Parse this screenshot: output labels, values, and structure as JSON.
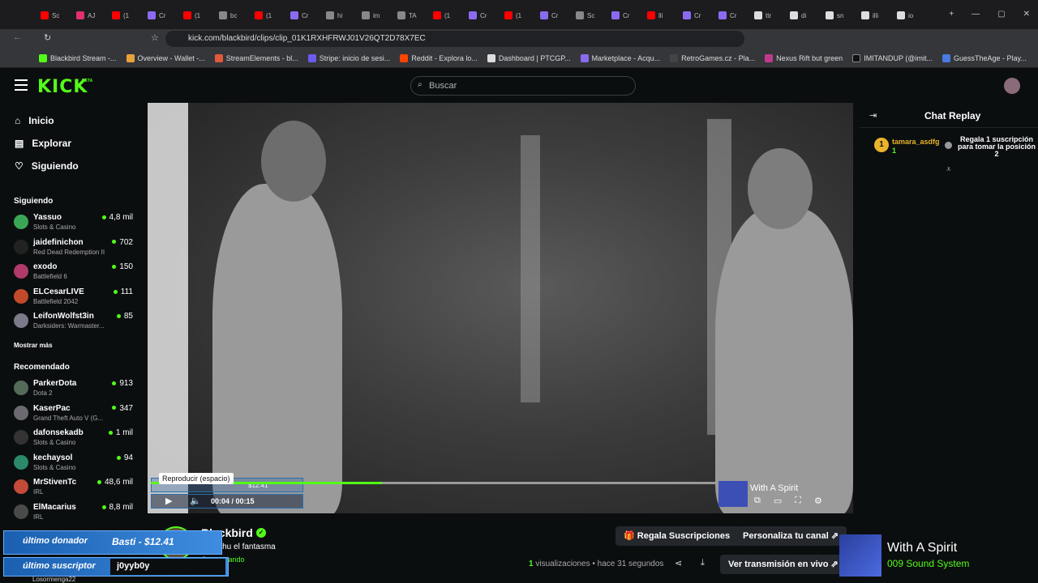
{
  "browser": {
    "tabs": [
      "Sc",
      "AJ",
      "(1",
      "Cr",
      "(1",
      "bc",
      "(1",
      "Cr",
      "hi",
      "im",
      "TA",
      "(1",
      "Cr",
      "(1",
      "Cr",
      "Sc",
      "Cr",
      "lli",
      "Cr",
      "Cr",
      "ttr",
      "di",
      "sn",
      "illi",
      "io"
    ],
    "url": "kick.com/blackbird/clips/clip_01K1RXHFRWJ01V26QT2D78X7EC",
    "bookmarks": [
      "Blackbird Stream -...",
      "Overview - Wallet -...",
      "StreamElements - bl...",
      "Stripe: inicio de sesi...",
      "Reddit - Explora lo...",
      "Dashboard | PTCGP...",
      "Marketplace - Acqu...",
      "RetroGames.cz - Pla...",
      "Nexus Rift but green",
      "IMITANDUP (@imit...",
      "GuessTheAge - Play..."
    ]
  },
  "header": {
    "logo": "KICK",
    "beta": "BETA",
    "search_placeholder": "Buscar"
  },
  "sidebar": {
    "nav": [
      {
        "label": "Inicio"
      },
      {
        "label": "Explorar"
      },
      {
        "label": "Siguiendo"
      }
    ],
    "following_title": "Siguiendo",
    "following": [
      {
        "name": "Yassuo",
        "category": "Slots & Casino",
        "viewers": "4,8 mil",
        "color": "#3aa655"
      },
      {
        "name": "jaidefinichon",
        "category": "Red Dead Redemption II",
        "viewers": "702",
        "color": "#222222"
      },
      {
        "name": "exodo",
        "category": "Battlefield 6",
        "viewers": "150",
        "color": "#b03a6a"
      },
      {
        "name": "ELCesarLIVE",
        "category": "Battlefield 2042",
        "viewers": "111",
        "color": "#c24a2a"
      },
      {
        "name": "LeifonWolfst3in",
        "category": "Darksiders: Warmaster...",
        "viewers": "85",
        "color": "#7a7a8a"
      }
    ],
    "show_more": "Mostrar más",
    "recommended_title": "Recomendado",
    "recommended": [
      {
        "name": "ParkerDota",
        "category": "Dota 2",
        "viewers": "913",
        "color": "#556b5a"
      },
      {
        "name": "KaserPac",
        "category": "Grand Theft Auto V (G...",
        "viewers": "347",
        "color": "#6a6a70"
      },
      {
        "name": "dafonsekadb",
        "category": "Slots & Casino",
        "viewers": "1 mil",
        "color": "#333333"
      },
      {
        "name": "kechaysol",
        "category": "Slots & Casino",
        "viewers": "94",
        "color": "#2a8a6a"
      },
      {
        "name": "MrStivenTc",
        "category": "IRL",
        "viewers": "48,6 mil",
        "color": "#c44a3a"
      },
      {
        "name": "ElMacarius",
        "category": "IRL",
        "viewers": "8,8 mil",
        "color": "#4a4a4a"
      }
    ],
    "cutoff_channel": "Losormenga22"
  },
  "player": {
    "tooltip": "Reproducir (espacio)",
    "time": "00:04 / 00:15",
    "progress_percent": 33,
    "now_playing": "With A Spirit"
  },
  "chat": {
    "title": "Chat Replay",
    "gift": {
      "rank": "1",
      "user": "tamara_asdfg",
      "count": "1",
      "message": "Regala 1 suscripción para tomar la posición 2"
    }
  },
  "clip": {
    "streamer": "Blackbird",
    "title": "dice chu el fantasma",
    "category": "Conversando",
    "views_count": "1",
    "views_label": "visualizaciones",
    "age": "hace 31 segundos",
    "gift_button": "Regala Suscripciones",
    "customize_button": "Personaliza tu canal",
    "live_button": "Ver transmisión en vivo"
  },
  "overlay": {
    "donor_label": "último donador",
    "donor_value": "Basti - $12.41",
    "donor_mini_value": "$12.41",
    "sub_label": "último suscriptor",
    "sub_value": "j0yyb0y",
    "song_title": "With A Spirit",
    "song_artist": "009 Sound System"
  }
}
